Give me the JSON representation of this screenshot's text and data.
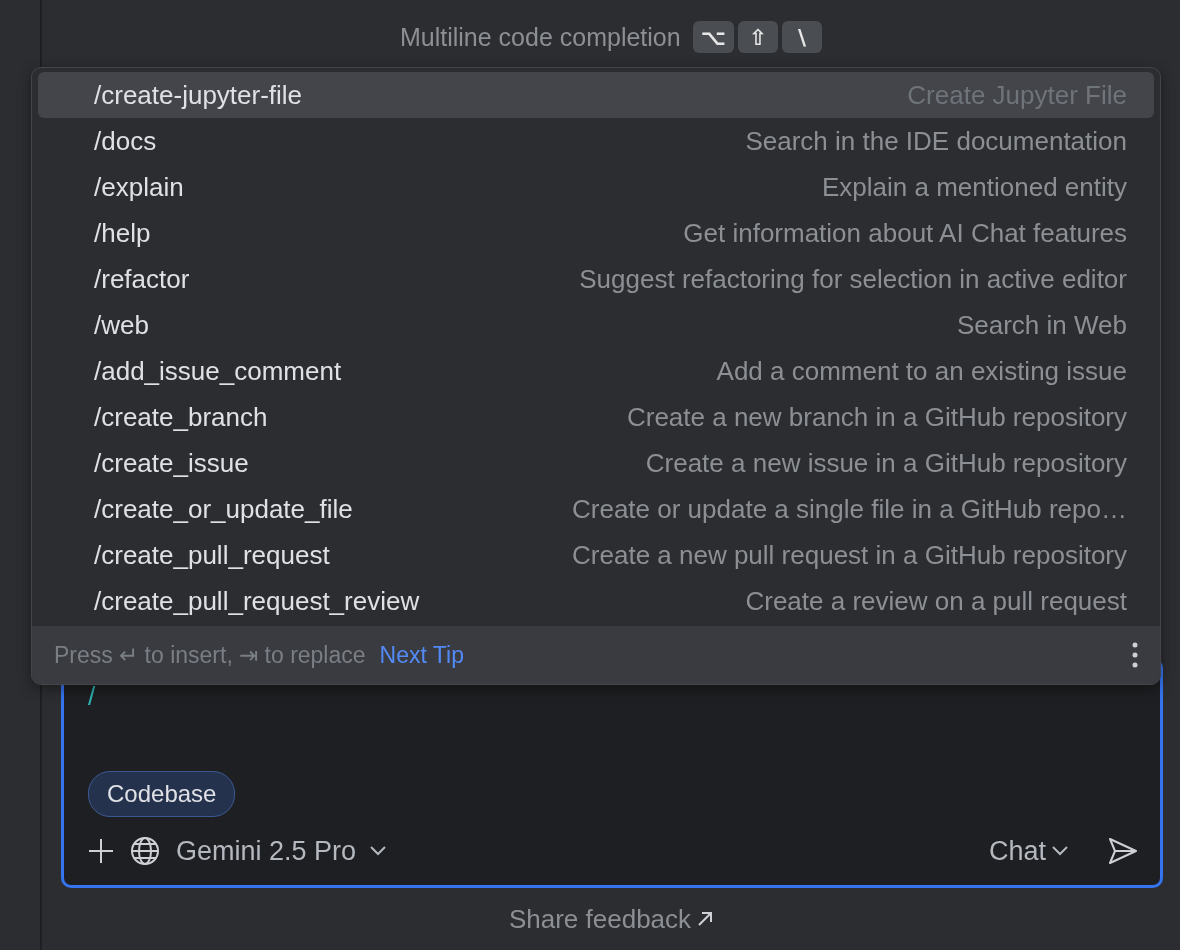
{
  "hint": {
    "label": "Multiline code completion",
    "keys": [
      "⌥",
      "⇧",
      "\\"
    ]
  },
  "commands": [
    {
      "command": "/create-jupyter-file",
      "description": "Create Jupyter File",
      "selected": true
    },
    {
      "command": "/docs",
      "description": "Search in the IDE documentation",
      "selected": false
    },
    {
      "command": "/explain",
      "description": "Explain a mentioned entity",
      "selected": false
    },
    {
      "command": "/help",
      "description": "Get information about AI Chat features",
      "selected": false
    },
    {
      "command": "/refactor",
      "description": "Suggest refactoring for selection in active editor",
      "selected": false
    },
    {
      "command": "/web",
      "description": "Search in Web",
      "selected": false
    },
    {
      "command": "/add_issue_comment",
      "description": "Add a comment to an existing issue",
      "selected": false
    },
    {
      "command": "/create_branch",
      "description": "Create a new branch in a GitHub repository",
      "selected": false
    },
    {
      "command": "/create_issue",
      "description": "Create a new issue in a GitHub repository",
      "selected": false
    },
    {
      "command": "/create_or_update_file",
      "description": "Create or update a single file in a GitHub repo…",
      "selected": false
    },
    {
      "command": "/create_pull_request",
      "description": "Create a new pull request in a GitHub repository",
      "selected": false
    },
    {
      "command": "/create_pull_request_review",
      "description": "Create a review on a pull request",
      "selected": false
    }
  ],
  "footer": {
    "tip": "Press ↵ to insert, ⇥ to replace",
    "link": "Next Tip"
  },
  "input": {
    "value": "/",
    "chips": [
      {
        "label": "Codebase"
      }
    ],
    "model": "Gemini 2.5 Pro",
    "mode": "Chat"
  },
  "feedback": {
    "label": "Share feedback"
  }
}
